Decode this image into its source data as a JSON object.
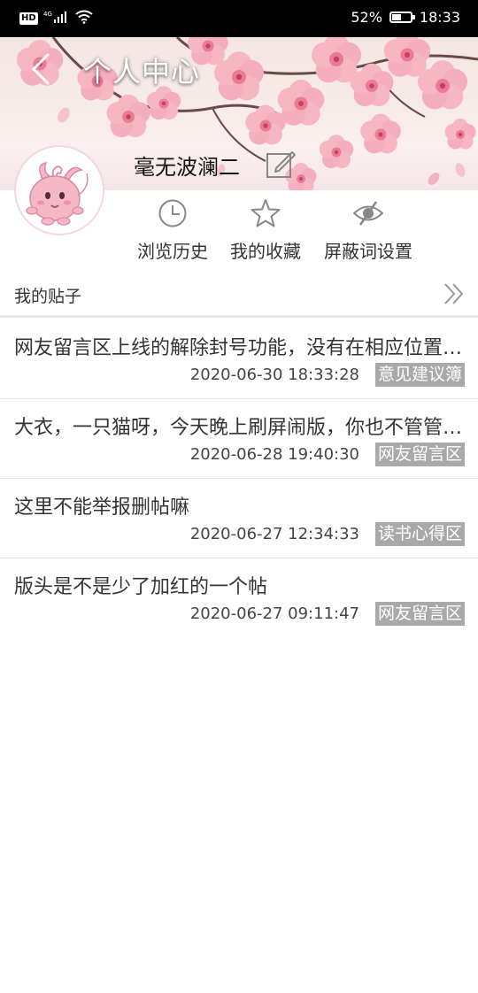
{
  "status_bar": {
    "network": "HD",
    "signal": "4G",
    "battery_percent": "52%",
    "battery_level": 0.52,
    "time": "18:33"
  },
  "header": {
    "title": "个人中心",
    "username": "毫无波澜二"
  },
  "actions": [
    {
      "label": "浏览历史",
      "icon": "clock-icon"
    },
    {
      "label": "我的收藏",
      "icon": "star-icon"
    },
    {
      "label": "屏蔽词设置",
      "icon": "eye-slash-icon"
    }
  ],
  "posts_section": {
    "title": "我的贴子"
  },
  "posts": [
    {
      "title": "网友留言区上线的解除封号功能，没有在相应位置上线……",
      "date": "2020-06-30 18:33:28",
      "tag": "意见建议簿"
    },
    {
      "title": "大衣，一只猫呀，今天晚上刷屏闹版，你也不管管……",
      "date": "2020-06-28 19:40:30",
      "tag": "网友留言区"
    },
    {
      "title": "这里不能举报删帖嘛",
      "date": "2020-06-27 12:34:33",
      "tag": "读书心得区"
    },
    {
      "title": "版头是不是少了加红的一个帖",
      "date": "2020-06-27 09:11:47",
      "tag": "网友留言区"
    }
  ],
  "colors": {
    "tag_bg": "#a9a9a9",
    "divider": "#e6e6e6",
    "blossom": "#f2a3b3"
  }
}
